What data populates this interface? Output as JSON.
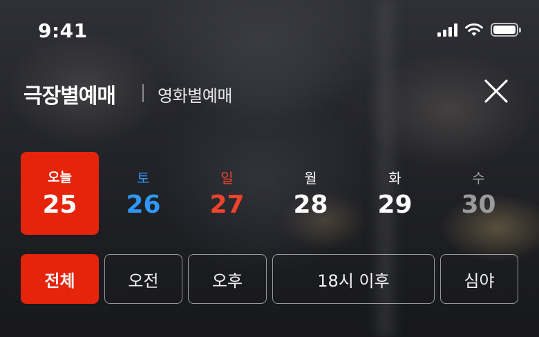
{
  "status_bar": {
    "time": "9:41",
    "icons": [
      "cellular-signal-icon",
      "wifi-icon",
      "battery-icon"
    ]
  },
  "header": {
    "tab_primary": "극장별예매",
    "tab_secondary": "영화별예매",
    "close_icon": "close-icon"
  },
  "dates": [
    {
      "day": "오늘",
      "num": "25",
      "selected": true
    },
    {
      "day": "토",
      "num": "26",
      "color": "#2f97f5"
    },
    {
      "day": "일",
      "num": "27",
      "color": "#f0432c"
    },
    {
      "day": "월",
      "num": "28",
      "color": "#ffffff"
    },
    {
      "day": "화",
      "num": "29",
      "color": "#ffffff"
    },
    {
      "day": "수",
      "num": "30",
      "color": "#9a9a9c"
    }
  ],
  "filters": [
    {
      "label": "전체",
      "active": true
    },
    {
      "label": "오전"
    },
    {
      "label": "오후"
    },
    {
      "label": "18시 이후"
    },
    {
      "label": "심야"
    }
  ],
  "colors": {
    "accent": "#e6230b",
    "saturday": "#2f97f5",
    "sunday": "#f0432c",
    "disabled": "#9a9a9c"
  }
}
